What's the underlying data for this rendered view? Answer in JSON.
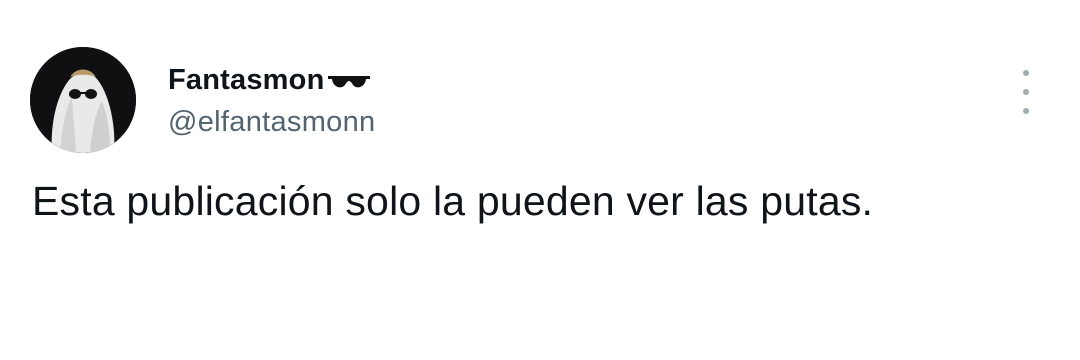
{
  "tweet": {
    "author": {
      "display_name": "Fantasmon",
      "handle": "@elfantasmonn",
      "name_emoji": "sunglasses-emoji",
      "avatar": "ghost-with-sunglasses-avatar"
    },
    "text": "Esta publicación solo la pueden ver las putas.",
    "more_menu_icon": "vertical-ellipsis-icon"
  },
  "colors": {
    "background": "#ffffff",
    "primary_text": "#0f1419",
    "secondary_text": "#536471",
    "icon_gray": "#a2acb3"
  }
}
